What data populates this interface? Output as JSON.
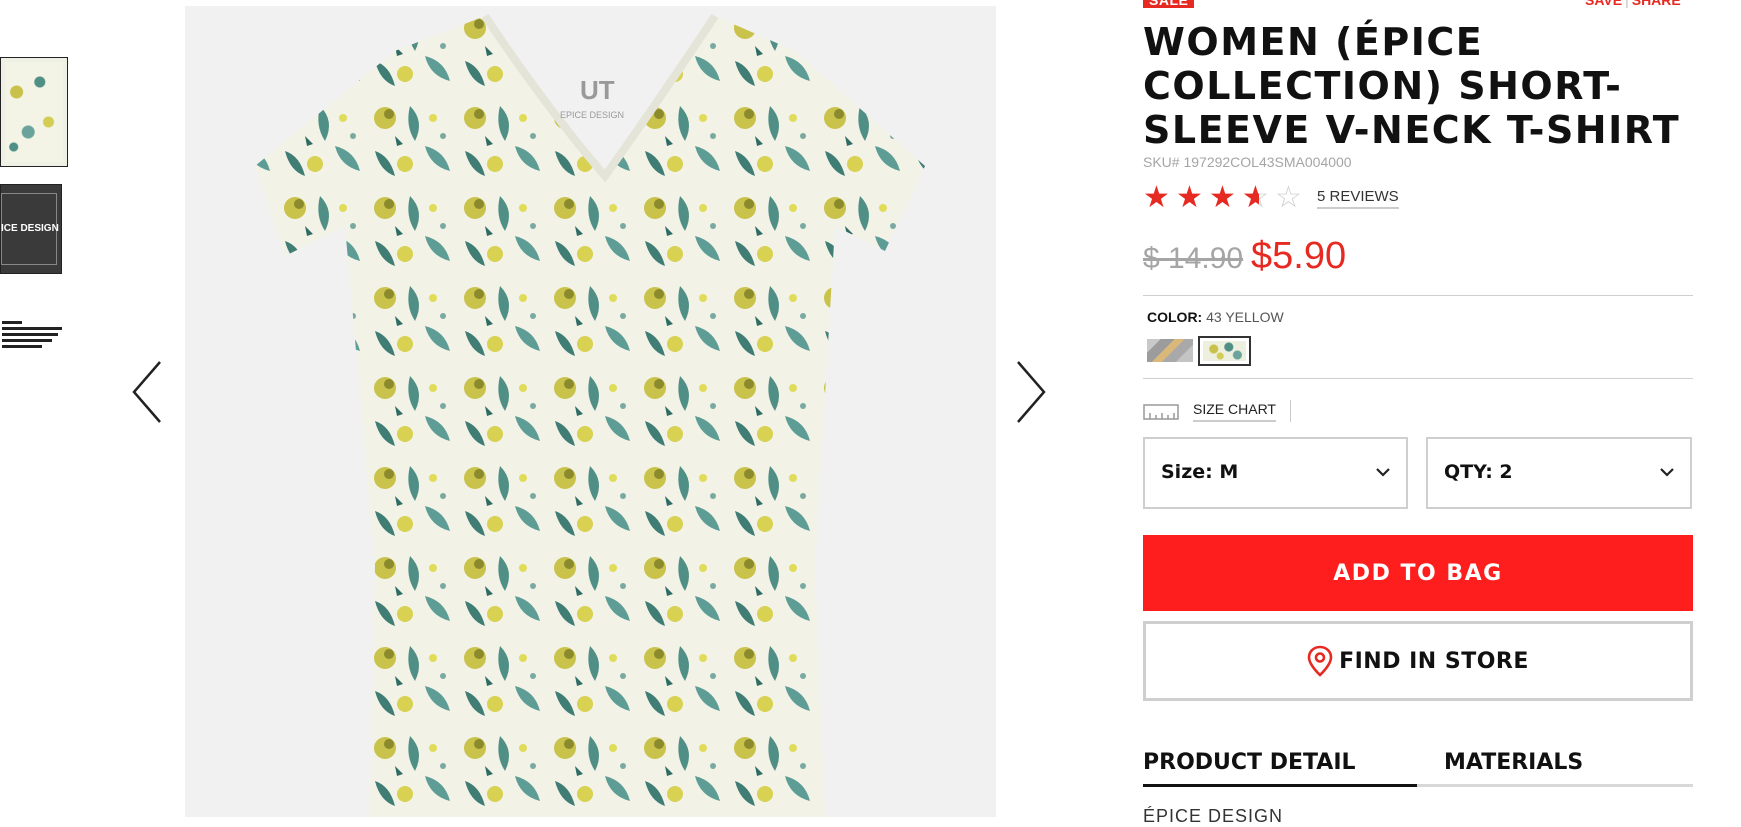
{
  "thumbnails": {
    "items": [
      {
        "name": "thumbnail-1",
        "selected": true
      },
      {
        "name": "thumbnail-2",
        "text": "ICE DESIGN"
      },
      {
        "name": "thumbnail-3"
      }
    ]
  },
  "product": {
    "badge": "SALE",
    "save_label": "SAVE",
    "share_label": "SHARE",
    "share_sep": "|",
    "title": "WOMEN (ÉPICE COLLECTION) SHORT-SLEEVE V-NECK T-SHIRT",
    "sku": "SKU# 197292COL43SMA004000",
    "rating": 3.5,
    "rating_max": 5,
    "reviews_label": "5 REVIEWS",
    "price_old": "$ 14.90",
    "price_new": "$5.90",
    "color_label": "COLOR:",
    "color_value": "43 YELLOW",
    "size_chart_label": "SIZE CHART",
    "size_select_label": "Size: M",
    "qty_select_label": "QTY: 2",
    "add_to_bag_label": "ADD TO BAG",
    "find_in_store_label": "FIND IN STORE"
  },
  "image_logo": {
    "brand": "UT",
    "sub": "EPICE DESIGN"
  },
  "tabs": [
    {
      "label": "PRODUCT DETAIL",
      "active": true
    },
    {
      "label": "MATERIALS",
      "active": false
    }
  ],
  "detail_preview": "ÉPICE DESIGN",
  "colors": {
    "accent": "#e62a22",
    "button": "#ff1e1e",
    "muted": "#a5a5a5"
  },
  "icons": {
    "prev": "chevron-left-icon",
    "next": "chevron-right-icon",
    "ruler": "ruler-icon",
    "dropdown": "chevron-down-icon",
    "location": "location-pin-icon",
    "star": "star-icon"
  }
}
